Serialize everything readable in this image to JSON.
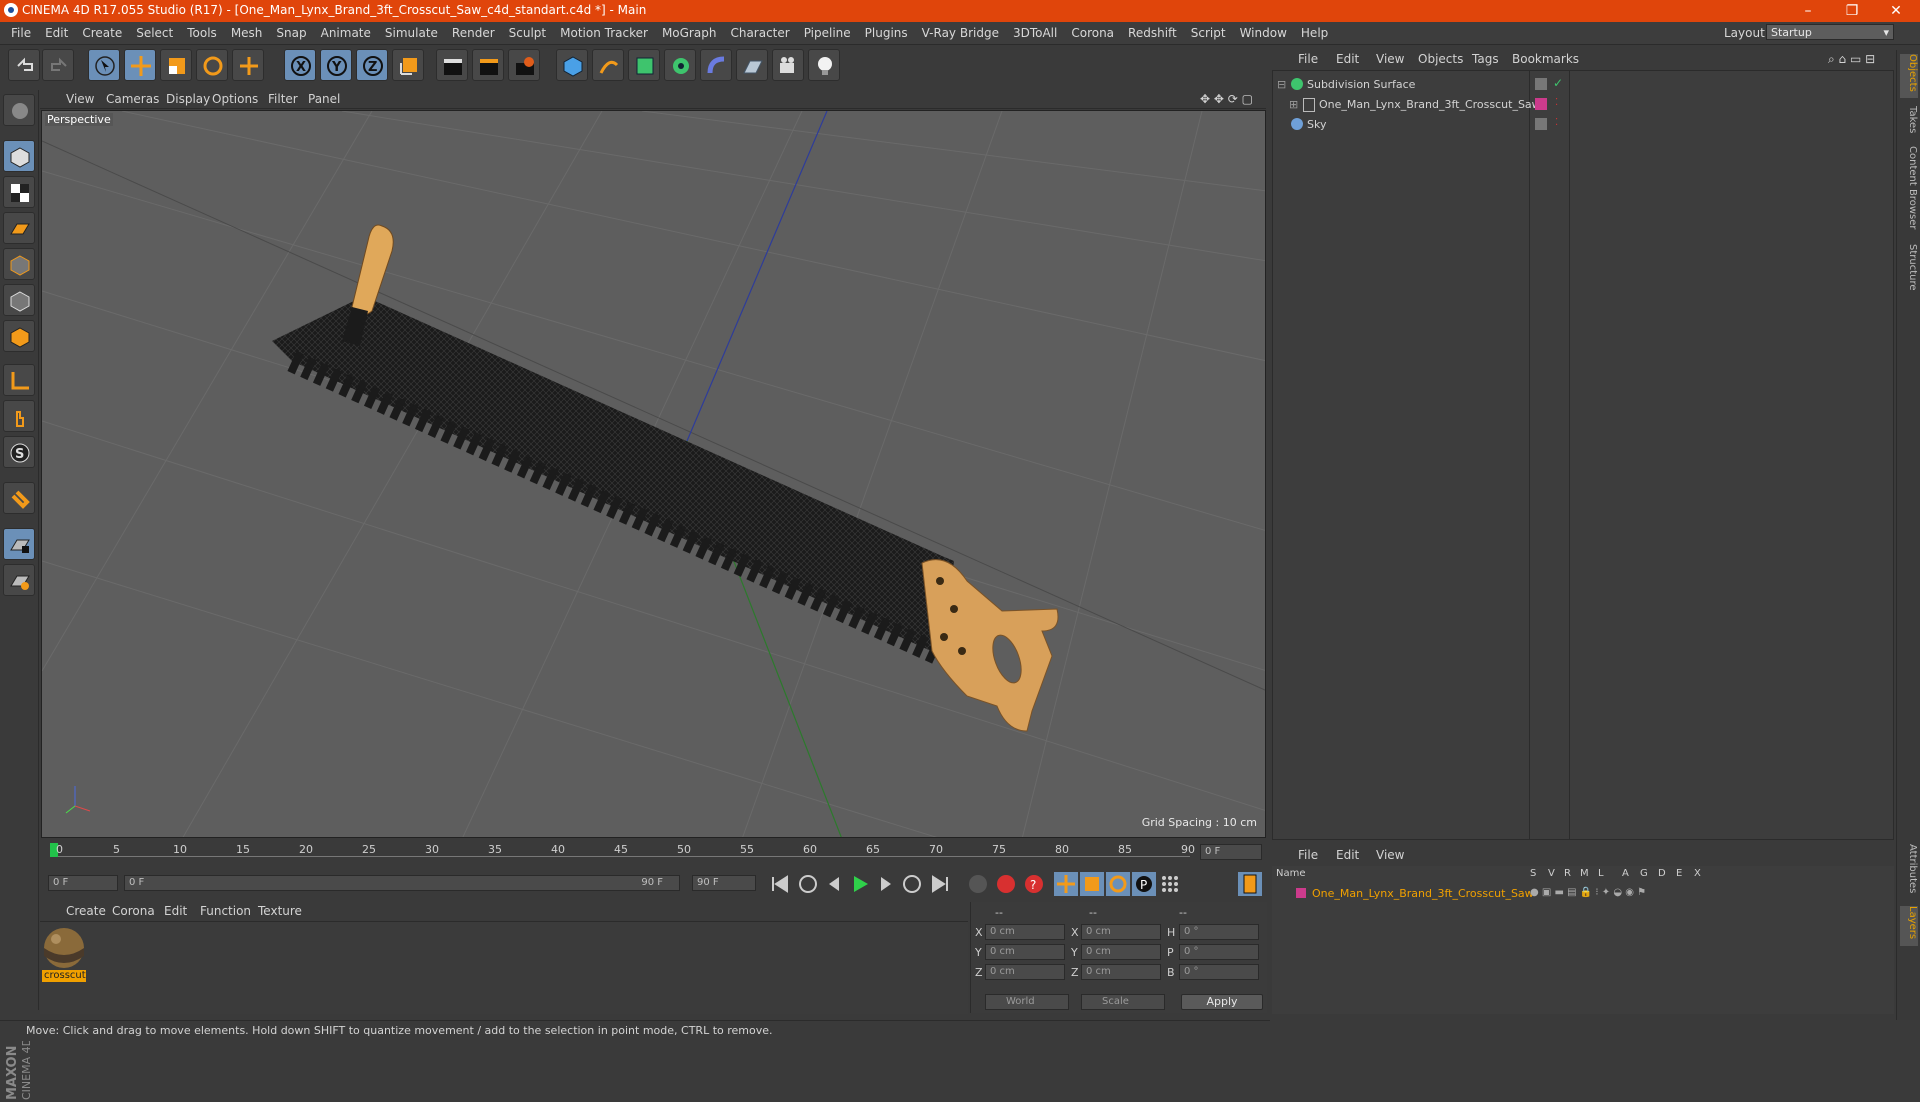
{
  "window": {
    "title": "CINEMA 4D R17.055 Studio (R17) - [One_Man_Lynx_Brand_3ft_Crosscut_Saw_c4d_standart.c4d *] - Main",
    "minimize": "–",
    "restore": "❐",
    "close": "✕"
  },
  "menu": {
    "items": [
      "File",
      "Edit",
      "Create",
      "Select",
      "Tools",
      "Mesh",
      "Snap",
      "Animate",
      "Simulate",
      "Render",
      "Sculpt",
      "Motion Tracker",
      "MoGraph",
      "Character",
      "Pipeline",
      "Plugins",
      "V-Ray Bridge",
      "3DToAll",
      "Corona",
      "Redshift",
      "Script",
      "Window",
      "Help"
    ],
    "layout_label": "Layout:",
    "layout_value": "Startup"
  },
  "viewport": {
    "menu": [
      "View",
      "Cameras",
      "Display",
      "Options",
      "Filter",
      "Panel"
    ],
    "label": "Perspective",
    "grid_spacing": "Grid Spacing : 10 cm"
  },
  "timeline": {
    "ticks": [
      "0",
      "5",
      "10",
      "15",
      "20",
      "25",
      "30",
      "35",
      "40",
      "45",
      "50",
      "55",
      "60",
      "65",
      "70",
      "75",
      "80",
      "85",
      "90"
    ],
    "current_frame": "0 F",
    "start_field": "0 F",
    "range_start": "0 F",
    "range_end": "90 F",
    "end_field": "90 F"
  },
  "material_manager": {
    "menu": [
      "Create",
      "Corona",
      "Edit",
      "Function",
      "Texture"
    ],
    "material_name": "crosscut"
  },
  "coordinates": {
    "headers": [
      "--",
      "--",
      "--"
    ],
    "pos_labels": [
      "X",
      "Y",
      "Z"
    ],
    "size_labels": [
      "X",
      "Y",
      "Z"
    ],
    "rot_labels": [
      "H",
      "P",
      "B"
    ],
    "pos_values": [
      "0 cm",
      "0 cm",
      "0 cm"
    ],
    "size_values": [
      "0 cm",
      "0 cm",
      "0 cm"
    ],
    "rot_values": [
      "0 °",
      "0 °",
      "0 °"
    ],
    "mode1": "World",
    "mode2": "Scale",
    "apply": "Apply"
  },
  "status": {
    "text": "Move: Click and drag to move elements. Hold down SHIFT to quantize movement / add to the selection in point mode, CTRL to remove."
  },
  "object_manager": {
    "menu": [
      "File",
      "Edit",
      "View",
      "Objects",
      "Tags",
      "Bookmarks"
    ],
    "objects": [
      {
        "name": "Subdivision Surface"
      },
      {
        "name": "One_Man_Lynx_Brand_3ft_Crosscut_Saw"
      },
      {
        "name": "Sky"
      }
    ]
  },
  "layer_manager": {
    "menu": [
      "File",
      "Edit",
      "View"
    ],
    "columns": [
      "Name",
      "S",
      "V",
      "R",
      "M",
      "L",
      "A",
      "G",
      "D",
      "E",
      "X"
    ],
    "layers": [
      {
        "name": "One_Man_Lynx_Brand_3ft_Crosscut_Saw",
        "color": "#cc3b8c"
      }
    ]
  },
  "right_tabs": [
    "Objects",
    "Takes",
    "Content Browser",
    "Structure",
    "Attributes",
    "Layers"
  ],
  "logo": {
    "brand": "MAXON",
    "product": "CINEMA 4D"
  },
  "colors": {
    "accent": "#e0450b",
    "selected": "#6b90b8",
    "material_label": "#f0a000",
    "layer_color": "#cc3b8c"
  }
}
